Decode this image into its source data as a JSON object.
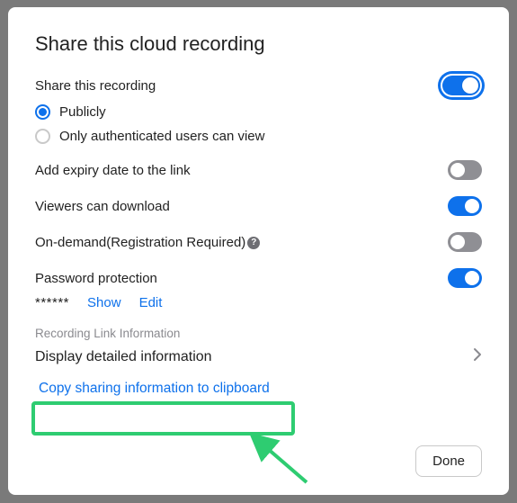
{
  "title": "Share this cloud recording",
  "share_recording": {
    "label": "Share this recording",
    "enabled": true,
    "options": {
      "public": "Publicly",
      "auth_only": "Only authenticated users can view",
      "selected": "public"
    }
  },
  "expiry": {
    "label": "Add expiry date to the link",
    "enabled": false
  },
  "download": {
    "label": "Viewers can download",
    "enabled": true
  },
  "on_demand": {
    "label": "On-demand(Registration Required)",
    "enabled": false
  },
  "password": {
    "label": "Password protection",
    "enabled": true,
    "masked": "******",
    "show_label": "Show",
    "edit_label": "Edit"
  },
  "link_info": {
    "header": "Recording Link Information",
    "display_detailed": "Display detailed information",
    "copy_label": "Copy sharing information to clipboard"
  },
  "done_label": "Done",
  "colors": {
    "accent": "#0E71EB",
    "highlight": "#2ECC71"
  }
}
